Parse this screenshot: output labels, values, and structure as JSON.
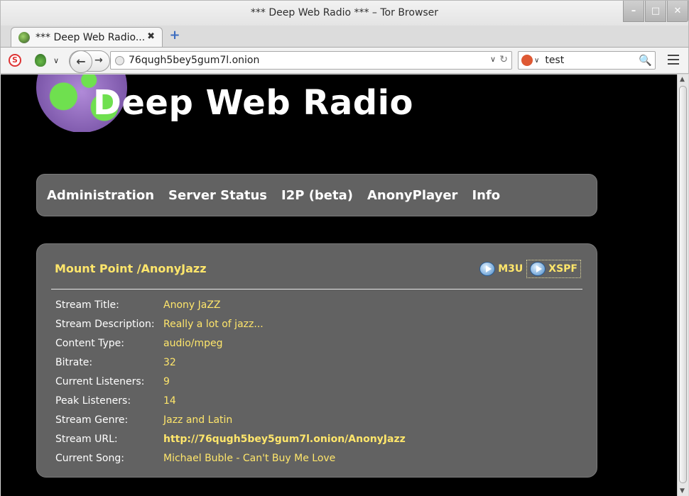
{
  "window": {
    "title": "*** Deep Web Radio *** – Tor Browser",
    "buttons": {
      "minimize": "–",
      "maximize": "□",
      "close": "✕"
    }
  },
  "tabs": [
    {
      "label": "*** Deep Web Radio...",
      "close": "✖"
    }
  ],
  "newtab": "+",
  "navbar": {
    "noscript_glyph": "S",
    "back_glyph": "←",
    "forward_glyph": "→",
    "url": "76qugh5bey5gum7l.onion",
    "url_dropdown": "∨",
    "reload_glyph": "↻",
    "search_value": "test",
    "search_glyph": "🔍",
    "dropdown_glyph": "∨"
  },
  "site": {
    "title": "Deep Web Radio",
    "menu": [
      "Administration",
      "Server Status",
      "I2P (beta)",
      "AnonyPlayer",
      "Info"
    ]
  },
  "mount": {
    "title": "Mount Point /AnonyJazz",
    "links": [
      "M3U",
      "XSPF"
    ],
    "rows": [
      {
        "key": "Stream Title:",
        "value": "Anony JaZZ"
      },
      {
        "key": "Stream Description:",
        "value": "Really a lot of jazz..."
      },
      {
        "key": "Content Type:",
        "value": "audio/mpeg"
      },
      {
        "key": "Bitrate:",
        "value": "32"
      },
      {
        "key": "Current Listeners:",
        "value": "9"
      },
      {
        "key": "Peak Listeners:",
        "value": "14"
      },
      {
        "key": "Stream Genre:",
        "value": "Jazz and Latin"
      },
      {
        "key": "Stream URL:",
        "value": "http://76qugh5bey5gum7l.onion/AnonyJazz"
      },
      {
        "key": "Current Song:",
        "value": "Michael Buble - Can't Buy Me Love"
      }
    ]
  },
  "scrollbar": {
    "up": "▲",
    "down": "▼"
  },
  "colors": {
    "accent_text": "#ffe66b",
    "panel": "#626262",
    "page_bg": "#000000"
  }
}
